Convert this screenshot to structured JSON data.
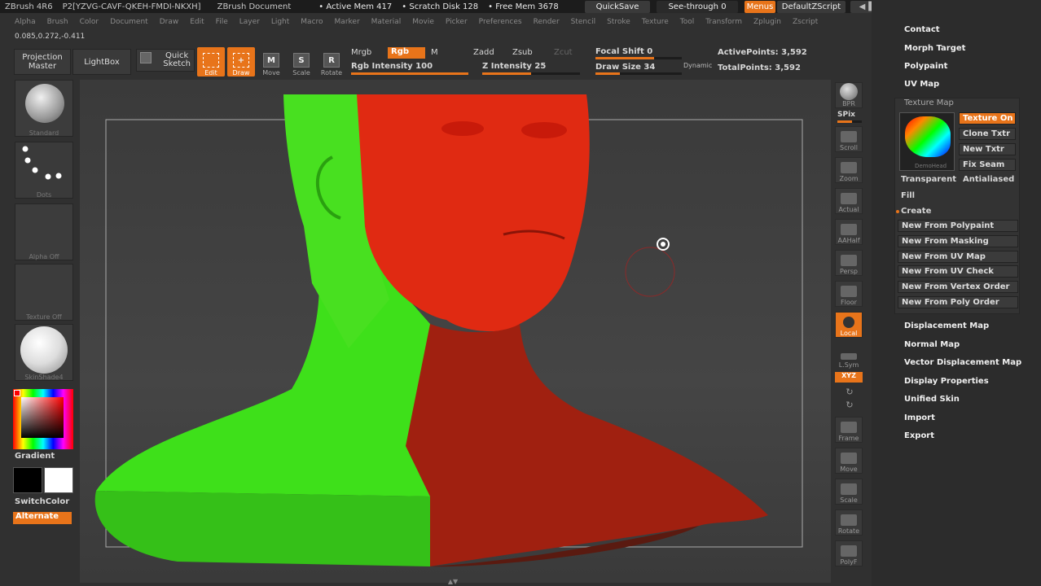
{
  "titlebar": {
    "app": "ZBrush 4R6",
    "doc_id": "P2[YZVG-CAVF-QKEH-FMDI-NKXH]",
    "doc": "ZBrush Document",
    "active_mem": "• Active Mem 417",
    "scratch": "• Scratch Disk 128",
    "free_mem": "• Free Mem 3678",
    "quicksave": "QuickSave",
    "seethrough": "See-through",
    "seethrough_val": "0",
    "menus": "Menus",
    "script": "DefaultZScript"
  },
  "menubar": [
    "Alpha",
    "Brush",
    "Color",
    "Document",
    "Draw",
    "Edit",
    "File",
    "Layer",
    "Light",
    "Macro",
    "Marker",
    "Material",
    "Movie",
    "Picker",
    "Preferences",
    "Render",
    "Stencil",
    "Stroke",
    "Texture",
    "Tool",
    "Transform",
    "Zplugin",
    "Zscript"
  ],
  "coords": "0.085,0.272,-0.411",
  "toolbar": {
    "projection": "Projection\nMaster",
    "lightbox": "LightBox",
    "quick_sketch": "Quick\nSketch",
    "edit": "Edit",
    "draw": "Draw",
    "move": "Move",
    "scale": "Scale",
    "rotate": "Rotate",
    "mrgb": "Mrgb",
    "rgb": "Rgb",
    "m": "M",
    "rgb_intensity": "Rgb Intensity 100",
    "zadd": "Zadd",
    "zsub": "Zsub",
    "zcut": "Zcut",
    "z_intensity": "Z Intensity 25",
    "focal_shift": "Focal Shift 0",
    "draw_size": "Draw Size 34",
    "dynamic": "Dynamic",
    "active_points": "ActivePoints: 3,592",
    "total_points": "TotalPoints: 3,592",
    "rgb_intensity_level": 1.0,
    "z_intensity_level": 0.25
  },
  "left": {
    "standard": "Standard",
    "dots": "Dots",
    "alpha_off": "Alpha Off",
    "texture_off": "Texture Off",
    "material": "SkinShade4",
    "gradient": "Gradient",
    "switchcolor": "SwitchColor",
    "alternate": "Alternate"
  },
  "rightbar": {
    "bpr": "BPR",
    "spix": "SPix",
    "scroll": "Scroll",
    "zoom": "Zoom",
    "actual": "Actual",
    "aahalf": "AAHalf",
    "persp": "Persp",
    "floor": "Floor",
    "local": "Local",
    "lsym": "L.Sym",
    "xyz": "XYZ",
    "frame": "Frame",
    "move": "Move",
    "scale": "Scale",
    "rotate": "Rotate",
    "polyf": "PolyF"
  },
  "sidepanel": {
    "contact": "Contact",
    "morph_target": "Morph Target",
    "polypaint": "Polypaint",
    "uv_map": "UV Map",
    "texture_map": "Texture Map",
    "texture_on": "Texture On",
    "clone_txtr": "Clone Txtr",
    "new_txtr": "New Txtr",
    "fix_seam": "Fix Seam",
    "thumb_caption": "DemoHead",
    "transparent": "Transparent",
    "antialiased": "Antialiased",
    "fill": "Fill",
    "create": "Create",
    "create_items": [
      "New From Polypaint",
      "New From Masking",
      "New From UV Map",
      "New From UV Check",
      "New From Vertex Order",
      "New From Poly Order"
    ],
    "displacement_map": "Displacement Map",
    "normal_map": "Normal Map",
    "vector_displacement_map": "Vector Displacement Map",
    "display_properties": "Display Properties",
    "unified_skin": "Unified Skin",
    "import": "Import",
    "export": "Export"
  },
  "colors": {
    "accent": "#e8741a",
    "green": "#3ee01a",
    "red": "#e02010"
  }
}
